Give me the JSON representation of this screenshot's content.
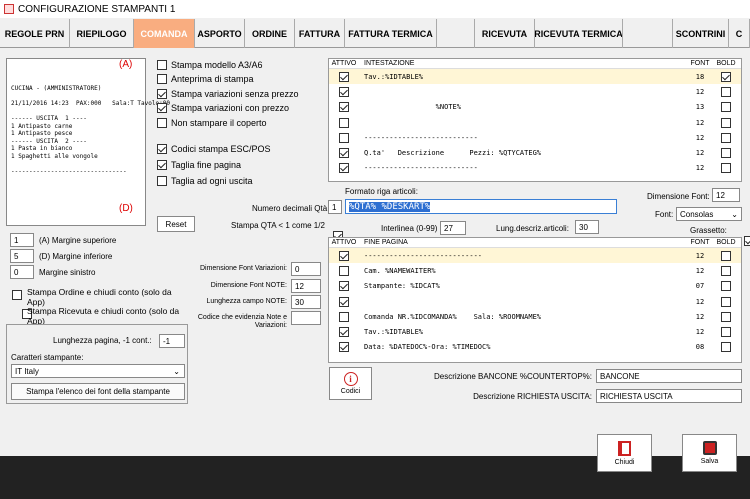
{
  "window": {
    "title": "CONFIGURAZIONE STAMPANTI 1"
  },
  "tabs": [
    {
      "label": "REGOLE PRN"
    },
    {
      "label": "RIEPILOGO"
    },
    {
      "label": "COMANDA",
      "active": true
    },
    {
      "label": "ASPORTO"
    },
    {
      "label": "ORDINE"
    },
    {
      "label": "FATTURA"
    },
    {
      "label": "FATTURA TERMICA"
    },
    {
      "label": ""
    },
    {
      "label": "RICEVUTA"
    },
    {
      "label": "RICEVUTA TERMICA"
    },
    {
      "label": ""
    },
    {
      "label": "SCONTRINI"
    },
    {
      "label": "C"
    }
  ],
  "preview": {
    "mark_a": "(A)",
    "mark_d": "(D)",
    "lines": [
      "CUCINA - (AMMINISTRATORE)",
      "",
      "21/11/2016 14:23  PAX:000   Sala:T Tavolo:00",
      "",
      "------ USCITA  1 ----",
      "1 Antipasto carne",
      "1 Antipasto pesce",
      "------ USCITA  2 ----",
      "1 Pasta in bianco",
      "1 Spaghetti alle vongole",
      "",
      "--------------------------------"
    ]
  },
  "options": [
    {
      "label": "Stampa modello A3/A6",
      "checked": false
    },
    {
      "label": "Anteprima di stampa",
      "checked": false
    },
    {
      "label": "Stampa variazioni senza prezzo",
      "checked": true
    },
    {
      "label": "Stampa variazioni con prezzo",
      "checked": true
    },
    {
      "label": "Non stampare il coperto",
      "checked": false
    },
    {
      "label": "Codici stampa ESC/POS",
      "checked": true
    },
    {
      "label": "Taglia fine pagina",
      "checked": true
    },
    {
      "label": "Taglia ad ogni uscita",
      "checked": false
    }
  ],
  "reset_label": "Reset",
  "margins": [
    {
      "value": "1",
      "label": "(A) Margine superiore"
    },
    {
      "value": "5",
      "label": "(D) Margine inferiore"
    },
    {
      "value": "0",
      "label": "Margine sinistro"
    }
  ],
  "extra_options": [
    {
      "label": "Stampa Ordine e chiudi conto (solo da App)",
      "checked": false
    },
    {
      "label": "Stampa Ricevuta e chiudi conto (solo da App)",
      "checked": false
    }
  ],
  "page_group": {
    "length_label": "Lunghezza pagina, -1 cont.:",
    "length_value": "-1",
    "charset_label": "Caratteri stampante:",
    "charset_value": "IT Italy",
    "print_fonts_label": "Stampa l'elenco dei font della stampante"
  },
  "font_fields": [
    {
      "label": "Dimensione Font Variazioni:",
      "value": "0"
    },
    {
      "label": "Dimensione Font NOTE:",
      "value": "12"
    },
    {
      "label": "Lunghezza campo NOTE:",
      "value": "30"
    },
    {
      "label": "Codice che evidenzia Note e Variazioni:",
      "value": ""
    }
  ],
  "header_grid": {
    "col_attivo": "ATTIVO",
    "col_text": "INTESTAZIONE",
    "col_font": "FONT",
    "col_bold": "BOLD",
    "rows": [
      {
        "on": true,
        "text": "Tav.:%IDTABLE%",
        "font": "18",
        "bold": true,
        "sel": true
      },
      {
        "on": true,
        "text": "",
        "font": "12",
        "bold": false
      },
      {
        "on": true,
        "text": "                 %NOTE%",
        "font": "13",
        "bold": false
      },
      {
        "on": false,
        "text": "",
        "font": "12",
        "bold": false
      },
      {
        "on": false,
        "text": "---------------------------",
        "font": "12",
        "bold": false
      },
      {
        "on": true,
        "text": "Q.ta'   Descrizione      Pezzi: %QTYCATEG%",
        "font": "12",
        "bold": false
      },
      {
        "on": true,
        "text": "---------------------------",
        "font": "12",
        "bold": false
      }
    ]
  },
  "article_format": {
    "decimals_label": "Numero decimali Qtà",
    "decimals_value": "1",
    "format_label": "Formato riga articoli:",
    "format_value": "%QTA% %DESKART%",
    "qta_label": "Stampa QTA < 1 come 1/2",
    "qta_checked": true,
    "interlinea_label": "Interlinea (0-99)",
    "interlinea_value": "27",
    "lung_label": "Lung.descriz.articoli:",
    "lung_value": "30",
    "dim_font_label": "Dimensione Font:",
    "dim_font_value": "12",
    "font_label": "Font:",
    "font_value": "Consolas",
    "bold_label": "Grassetto:",
    "bold_checked": true
  },
  "footer_grid": {
    "col_attivo": "ATTIVO",
    "col_text": "FINE PAGINA",
    "col_font": "FONT",
    "col_bold": "BOLD",
    "rows": [
      {
        "on": true,
        "text": "----------------------------",
        "font": "12",
        "bold": false,
        "sel": true
      },
      {
        "on": false,
        "text": "Cam. %NAMEWAITER%",
        "font": "12",
        "bold": false
      },
      {
        "on": true,
        "text": "Stampante: %IDCAT%",
        "font": "07",
        "bold": false
      },
      {
        "on": true,
        "text": "",
        "font": "12",
        "bold": false
      },
      {
        "on": false,
        "text": "Comanda NR.%IDCOMANDA%    Sala: %ROOMNAME%",
        "font": "12",
        "bold": false
      },
      {
        "on": true,
        "text": "Tav.:%IDTABLE%",
        "font": "12",
        "bold": false
      },
      {
        "on": true,
        "text": "Data: %DATEDOC%-Ora: %TIMEDOC%",
        "font": "08",
        "bold": false
      }
    ]
  },
  "codici_label": "Codici",
  "desc_fields": [
    {
      "label": "Descrizione BANCONE  %COUNTERTOP%:",
      "value": "BANCONE"
    },
    {
      "label": "Descrizione RICHIESTA USCITA:",
      "value": "RICHIESTA USCITA"
    }
  ],
  "actions": {
    "close_label": "Chiudi",
    "save_label": "Salva"
  }
}
